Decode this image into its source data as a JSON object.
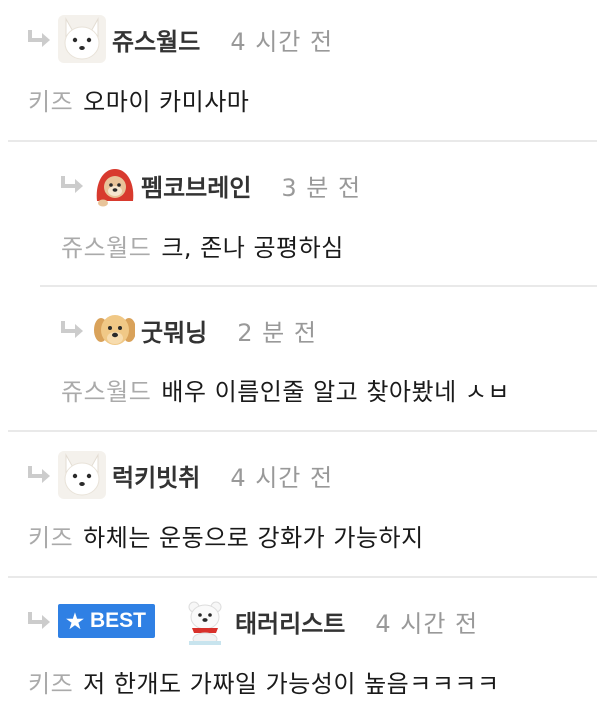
{
  "comments": [
    {
      "nickname": "쥬스월드",
      "time": "4 시간 전",
      "mention": "키즈",
      "text": "오마이 카미사마",
      "avatar": "white-fox-avatar",
      "depth": 1
    },
    {
      "nickname": "펨코브레인",
      "time": "3 분 전",
      "mention": "쥬스월드",
      "text": "크, 존나 공평하심",
      "avatar": "puppy-in-red-hood-avatar",
      "depth": 2
    },
    {
      "nickname": "굿뭐닝",
      "time": "2 분 전",
      "mention": "쥬스월드",
      "text": "배우 이름인줄 알고 찾아봤네 ㅅㅂ",
      "avatar": "golden-retriever-puppy-avatar",
      "depth": 2
    },
    {
      "nickname": "럭키빗취",
      "time": "4 시간 전",
      "mention": "키즈",
      "text": "하체는 운동으로 강화가 가능하지",
      "avatar": "white-fox-avatar",
      "depth": 1
    },
    {
      "nickname": "태러리스트",
      "time": "4 시간 전",
      "mention": "키즈",
      "text": "저 한개도 가짜일 가능성이 높음ㅋㅋㅋㅋ",
      "avatar": "polar-bear-with-red-scarf-avatar",
      "depth": 1,
      "badge": "BEST"
    }
  ],
  "colors": {
    "nickname": "#333333",
    "time": "#999999",
    "mention": "#aaaaaa",
    "body": "#1a1a1a",
    "divider": "#e9e9e9",
    "best_badge": "#2f80e4",
    "reply_arrow": "#cccccc"
  }
}
